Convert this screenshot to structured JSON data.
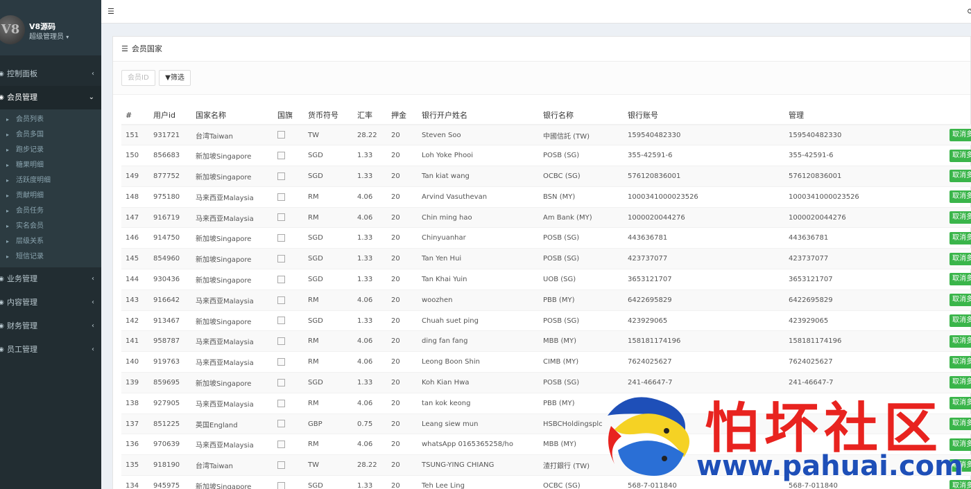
{
  "sidebar": {
    "logo_text": "V8",
    "user_name": "V8源码",
    "user_role": "超级管理员",
    "menu": [
      {
        "label": "控制面板",
        "active": false
      },
      {
        "label": "会员管理",
        "active": true
      },
      {
        "label": "业务管理",
        "active": false
      },
      {
        "label": "内容管理",
        "active": false
      },
      {
        "label": "财务管理",
        "active": false
      },
      {
        "label": "员工管理",
        "active": false
      }
    ],
    "submenu": [
      "会员列表",
      "会员多国",
      "跑步记录",
      "糖果明细",
      "活跃度明细",
      "贡献明细",
      "会员任务",
      "实名会员",
      "层级关系",
      "短信记录"
    ]
  },
  "topbar": {
    "toggle_icon": "menu-toggle-icon",
    "refresh_icon": "refresh-icon"
  },
  "panel": {
    "title": "会员国家",
    "search_placeholder": "会员ID",
    "filter_label": "筛选"
  },
  "table": {
    "headers": [
      "#",
      "用户id",
      "国家名称",
      "国旗",
      "货币符号",
      "汇率",
      "押金",
      "银行开户姓名",
      "银行名称",
      "银行账号",
      "管理"
    ],
    "action_label": "取消多",
    "rows": [
      [
        "151",
        "931721",
        "台湾Taiwan",
        "TW",
        "28.22",
        "20",
        "Steven Soo",
        "中國信託 (TW)",
        "159540482330",
        "159540482330"
      ],
      [
        "150",
        "856683",
        "新加坡Singapore",
        "SGD",
        "1.33",
        "20",
        "Loh Yoke Phooi",
        "POSB (SG)",
        "355-42591-6",
        "355-42591-6"
      ],
      [
        "149",
        "877752",
        "新加坡Singapore",
        "SGD",
        "1.33",
        "20",
        "Tan kiat wang",
        "OCBC (SG)",
        "576120836001",
        "576120836001"
      ],
      [
        "148",
        "975180",
        "马来西亚Malaysia",
        "RM",
        "4.06",
        "20",
        "Arvind Vasuthevan",
        "BSN (MY)",
        "1000341000023526",
        "1000341000023526"
      ],
      [
        "147",
        "916719",
        "马来西亚Malaysia",
        "RM",
        "4.06",
        "20",
        "Chin ming hao",
        "Am Bank (MY)",
        "1000020044276",
        "1000020044276"
      ],
      [
        "146",
        "914750",
        "新加坡Singapore",
        "SGD",
        "1.33",
        "20",
        "Chinyuanhar",
        "POSB (SG)",
        "443636781",
        "443636781"
      ],
      [
        "145",
        "854960",
        "新加坡Singapore",
        "SGD",
        "1.33",
        "20",
        "Tan Yen Hui",
        "POSB (SG)",
        "423737077",
        "423737077"
      ],
      [
        "144",
        "930436",
        "新加坡Singapore",
        "SGD",
        "1.33",
        "20",
        "Tan Khai Yuin",
        "UOB (SG)",
        "3653121707",
        "3653121707"
      ],
      [
        "143",
        "916642",
        "马来西亚Malaysia",
        "RM",
        "4.06",
        "20",
        "woozhen",
        "PBB (MY)",
        "6422695829",
        "6422695829"
      ],
      [
        "142",
        "913467",
        "新加坡Singapore",
        "SGD",
        "1.33",
        "20",
        "Chuah suet ping",
        "POSB (SG)",
        "423929065",
        "423929065"
      ],
      [
        "141",
        "958787",
        "马来西亚Malaysia",
        "RM",
        "4.06",
        "20",
        "ding fan fang",
        "MBB (MY)",
        "158181174196",
        "158181174196"
      ],
      [
        "140",
        "919763",
        "马来西亚Malaysia",
        "RM",
        "4.06",
        "20",
        "Leong Boon Shin",
        "CIMB (MY)",
        "7624025627",
        "7624025627"
      ],
      [
        "139",
        "859695",
        "新加坡Singapore",
        "SGD",
        "1.33",
        "20",
        "Koh Kian Hwa",
        "POSB (SG)",
        "241-46647-7",
        "241-46647-7"
      ],
      [
        "138",
        "927905",
        "马来西亚Malaysia",
        "RM",
        "4.06",
        "20",
        "tan kok keong",
        "PBB (MY)",
        "",
        ""
      ],
      [
        "137",
        "851225",
        "英国England",
        "GBP",
        "0.75",
        "20",
        "Leang siew mun",
        "HSBCHoldingsplc",
        "",
        ""
      ],
      [
        "136",
        "970639",
        "马来西亚Malaysia",
        "RM",
        "4.06",
        "20",
        "whatsApp 0165365258/ho",
        "MBB (MY)",
        "",
        ""
      ],
      [
        "135",
        "918190",
        "台湾Taiwan",
        "TW",
        "28.22",
        "20",
        "TSUNG-YING CHIANG",
        "渣打銀行 (TW)",
        "",
        ""
      ],
      [
        "134",
        "945975",
        "新加坡Singapore",
        "SGD",
        "1.33",
        "20",
        "Teh Lee Ling",
        "OCBC (SG)",
        "568-7-011840",
        "568-7-011840"
      ]
    ]
  },
  "watermark": {
    "title": "怕坏社区",
    "url": "www.pahuai.com"
  }
}
